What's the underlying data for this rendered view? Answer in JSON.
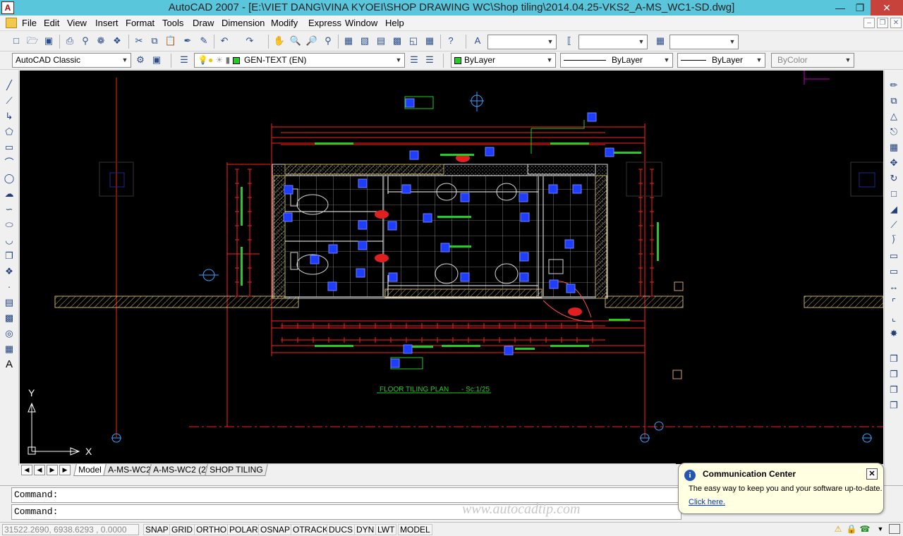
{
  "window": {
    "title": "AutoCAD 2007 - [E:\\VIET DANG\\VINA KYOEI\\SHOP DRAWING WC\\Shop tiling\\2014.04.25-VKS2_A-MS_WC1-SD.dwg]",
    "app_icon_letter": "A"
  },
  "menu": [
    "File",
    "Edit",
    "View",
    "Insert",
    "Format",
    "Tools",
    "Draw",
    "Dimension",
    "Modify",
    "Window",
    "Help",
    "Express"
  ],
  "toolbar": {
    "workspace": "AutoCAD Classic",
    "layer": "GEN-TEXT (EN)",
    "color": "ByLayer",
    "linetype": "ByLayer",
    "lineweight": "ByLayer",
    "plotstyle": "ByColor",
    "text_style": "",
    "dim_style": "",
    "table_style": ""
  },
  "drawing": {
    "plan_title": "FLOOR TILING PLAN",
    "plan_scale": "- Sc:1/25",
    "ucs_y": "Y",
    "ucs_x": "X"
  },
  "tabs": [
    "Model",
    "A-MS-WC2",
    "A-MS-WC2 (2)",
    "SHOP TILING"
  ],
  "command": {
    "line1": "Command:",
    "line2": "Command:"
  },
  "watermark": "www.autocadtip.com",
  "status": {
    "coords": "31522.2690, 6938.6293 , 0.0000",
    "buttons": [
      "SNAP",
      "GRID",
      "ORTHO",
      "POLAR",
      "OSNAP",
      "OTRACK",
      "DUCS",
      "DYN",
      "LWT",
      "MODEL"
    ]
  },
  "notification": {
    "title": "Communication Center",
    "body": "The easy way to keep you and your software up-to-date.",
    "link": "Click here."
  },
  "colors": {
    "titlebar": "#5ac6dc",
    "canvas": "#000000",
    "red": "#ff2020",
    "green": "#22cc22",
    "grip": "#1f3dff"
  }
}
